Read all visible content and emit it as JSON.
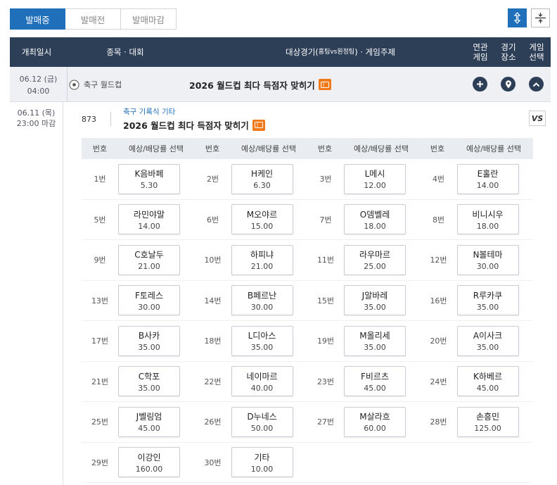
{
  "tabs": [
    "발매중",
    "발매전",
    "발매마감"
  ],
  "header": {
    "date": "개최일시",
    "sport": "종목 · 대회",
    "target_a": "대상경기(",
    "target_small": "홈팀vs원정팀",
    "target_b": ") · 게임주제",
    "related_1": "연관",
    "related_2": "게임",
    "venue_1": "경기",
    "venue_2": "장소",
    "select_1": "게임",
    "select_2": "선택"
  },
  "match": {
    "date_line1": "06.12 (금)",
    "date_line2": "04:00",
    "sport": "축구 월드컵",
    "title": "2026 월드컵 최다 득점자 맞히기"
  },
  "game": {
    "close_line1": "06.11 (목)",
    "close_line2": "23:00 마감",
    "number": "873",
    "category": "축구 기록식 기타",
    "title": "2026 월드컵 최다 득점자 맞히기",
    "vs_label": "VS"
  },
  "odds_header": {
    "num": "번호",
    "select": "예상/배당률 선택"
  },
  "options": [
    {
      "no": "1번",
      "name": "K음바페",
      "odds": "5.30"
    },
    {
      "no": "2번",
      "name": "H케인",
      "odds": "6.30"
    },
    {
      "no": "3번",
      "name": "L메시",
      "odds": "12.00"
    },
    {
      "no": "4번",
      "name": "E홀란",
      "odds": "14.00"
    },
    {
      "no": "5번",
      "name": "라민야말",
      "odds": "14.00"
    },
    {
      "no": "6번",
      "name": "M오야르",
      "odds": "15.00"
    },
    {
      "no": "7번",
      "name": "O뎀벨레",
      "odds": "18.00"
    },
    {
      "no": "8번",
      "name": "비니시우",
      "odds": "18.00"
    },
    {
      "no": "9번",
      "name": "C호날두",
      "odds": "21.00"
    },
    {
      "no": "10번",
      "name": "하피냐",
      "odds": "21.00"
    },
    {
      "no": "11번",
      "name": "라우마르",
      "odds": "25.00"
    },
    {
      "no": "12번",
      "name": "N볼테마",
      "odds": "30.00"
    },
    {
      "no": "13번",
      "name": "F토레스",
      "odds": "30.00"
    },
    {
      "no": "14번",
      "name": "B페르난",
      "odds": "30.00"
    },
    {
      "no": "15번",
      "name": "J알바레",
      "odds": "35.00"
    },
    {
      "no": "16번",
      "name": "R루카쿠",
      "odds": "35.00"
    },
    {
      "no": "17번",
      "name": "B사카",
      "odds": "35.00"
    },
    {
      "no": "18번",
      "name": "L디아스",
      "odds": "35.00"
    },
    {
      "no": "19번",
      "name": "M올리세",
      "odds": "35.00"
    },
    {
      "no": "20번",
      "name": "A이사크",
      "odds": "35.00"
    },
    {
      "no": "21번",
      "name": "C학포",
      "odds": "35.00"
    },
    {
      "no": "22번",
      "name": "네이마르",
      "odds": "40.00"
    },
    {
      "no": "23번",
      "name": "F비르츠",
      "odds": "45.00"
    },
    {
      "no": "24번",
      "name": "K하베르",
      "odds": "45.00"
    },
    {
      "no": "25번",
      "name": "J벨링엄",
      "odds": "45.00"
    },
    {
      "no": "26번",
      "name": "D누네스",
      "odds": "50.00"
    },
    {
      "no": "27번",
      "name": "M살라흐",
      "odds": "60.00"
    },
    {
      "no": "28번",
      "name": "손흥민",
      "odds": "125.00"
    },
    {
      "no": "29번",
      "name": "이강인",
      "odds": "160.00"
    },
    {
      "no": "30번",
      "name": "기타",
      "odds": "10.00"
    }
  ],
  "colors": {
    "primary": "#1f6fba",
    "header_bg": "#2d3e57",
    "ticket": "#f27a1a"
  }
}
